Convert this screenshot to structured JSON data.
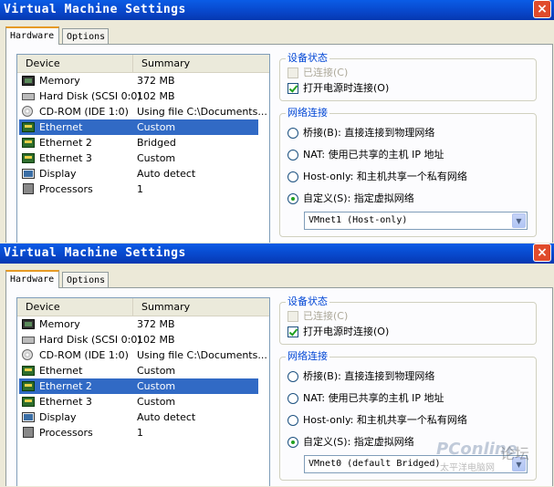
{
  "windows": [
    {
      "title": "Virtual Machine Settings",
      "close_label": "×",
      "tabs": [
        "Hardware",
        "Options"
      ],
      "list_headers": {
        "device": "Device",
        "summary": "Summary"
      },
      "devices": [
        {
          "name": "Memory",
          "summary": "372 MB",
          "icon": "memory-icon",
          "selected": false
        },
        {
          "name": "Hard Disk (SCSI 0:0)",
          "summary": "102 MB",
          "icon": "hard-disk-icon",
          "selected": false
        },
        {
          "name": "CD-ROM (IDE 1:0)",
          "summary": "Using file C:\\Documents...",
          "icon": "cdrom-icon",
          "selected": false
        },
        {
          "name": "Ethernet",
          "summary": "Custom",
          "icon": "ethernet-icon",
          "selected": true
        },
        {
          "name": "Ethernet 2",
          "summary": "Bridged",
          "icon": "ethernet-icon",
          "selected": false
        },
        {
          "name": "Ethernet 3",
          "summary": "Custom",
          "icon": "ethernet-icon",
          "selected": false
        },
        {
          "name": "Display",
          "summary": "Auto detect",
          "icon": "display-icon",
          "selected": false
        },
        {
          "name": "Processors",
          "summary": "1",
          "icon": "processor-icon",
          "selected": false
        }
      ],
      "device_status": {
        "title": "设备状态",
        "connected": {
          "label": "已连接(C)",
          "checked": false,
          "disabled": true
        },
        "connect_at_power_on": {
          "label": "打开电源时连接(O)",
          "checked": true,
          "disabled": false
        }
      },
      "network": {
        "title": "网络连接",
        "options": [
          {
            "label": "桥接(B): 直接连接到物理网络",
            "selected": false
          },
          {
            "label": "NAT: 使用已共享的主机 IP 地址",
            "selected": false
          },
          {
            "label": "Host-only: 和主机共享一个私有网络",
            "selected": false
          },
          {
            "label": "自定义(S): 指定虚拟网络",
            "selected": true
          }
        ],
        "custom_network_value": "VMnet1 (Host-only)"
      }
    },
    {
      "title": "Virtual Machine Settings",
      "close_label": "×",
      "tabs": [
        "Hardware",
        "Options"
      ],
      "list_headers": {
        "device": "Device",
        "summary": "Summary"
      },
      "devices": [
        {
          "name": "Memory",
          "summary": "372 MB",
          "icon": "memory-icon",
          "selected": false
        },
        {
          "name": "Hard Disk (SCSI 0:0)",
          "summary": "102 MB",
          "icon": "hard-disk-icon",
          "selected": false
        },
        {
          "name": "CD-ROM (IDE 1:0)",
          "summary": "Using file C:\\Documents...",
          "icon": "cdrom-icon",
          "selected": false
        },
        {
          "name": "Ethernet",
          "summary": "Custom",
          "icon": "ethernet-icon",
          "selected": false
        },
        {
          "name": "Ethernet 2",
          "summary": "Custom",
          "icon": "ethernet-icon",
          "selected": true
        },
        {
          "name": "Ethernet 3",
          "summary": "Custom",
          "icon": "ethernet-icon",
          "selected": false
        },
        {
          "name": "Display",
          "summary": "Auto detect",
          "icon": "display-icon",
          "selected": false
        },
        {
          "name": "Processors",
          "summary": "1",
          "icon": "processor-icon",
          "selected": false
        }
      ],
      "device_status": {
        "title": "设备状态",
        "connected": {
          "label": "已连接(C)",
          "checked": false,
          "disabled": true
        },
        "connect_at_power_on": {
          "label": "打开电源时连接(O)",
          "checked": true,
          "disabled": false
        }
      },
      "network": {
        "title": "网络连接",
        "options": [
          {
            "label": "桥接(B): 直接连接到物理网络",
            "selected": false
          },
          {
            "label": "NAT: 使用已共享的主机 IP 地址",
            "selected": false
          },
          {
            "label": "Host-only: 和主机共享一个私有网络",
            "selected": false
          },
          {
            "label": "自定义(S): 指定虚拟网络",
            "selected": true
          }
        ],
        "custom_network_value": "VMnet0 (default Bridged)"
      }
    }
  ],
  "watermark": {
    "brand": "PConline",
    "forum": "论坛",
    "sub": "太平洋电脑网"
  },
  "colors": {
    "title_bar": "#0a5ce6",
    "selection": "#316ac5",
    "group_label": "#0046d5",
    "close_button": "#e04b2b"
  }
}
